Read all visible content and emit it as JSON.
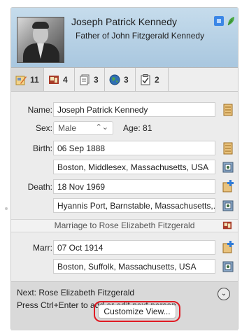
{
  "header": {
    "name": "Joseph Patrick Kennedy",
    "subtitle": "Father of John Fitzgerald Kennedy",
    "accent_color": "#3b86e6"
  },
  "tabs": [
    {
      "icon": "edit-person-icon",
      "count": "11"
    },
    {
      "icon": "media-icon",
      "count": "4"
    },
    {
      "icon": "sources-icon",
      "count": "3"
    },
    {
      "icon": "globe-icon",
      "count": "3"
    },
    {
      "icon": "tasks-icon",
      "count": "2"
    }
  ],
  "fields": {
    "name_label": "Name:",
    "name_value": "Joseph Patrick Kennedy",
    "sex_label": "Sex:",
    "sex_value": "Male",
    "age_label": "Age:",
    "age_value": "81",
    "birth_label": "Birth:",
    "birth_date": "06 Sep 1888",
    "birth_place": "Boston, Middlesex, Massachusetts, USA",
    "death_label": "Death:",
    "death_date": "18 Nov 1969",
    "death_place": "Hyannis Port, Barnstable, Massachusetts,...",
    "marriage_header": "Marriage to Rose Elizabeth Fitzgerald",
    "marr_label": "Marr:",
    "marr_date": "07 Oct 1914",
    "marr_place": "Boston, Suffolk, Massachusetts, USA"
  },
  "next": {
    "line1": "Next:  Rose Elizabeth Fitzgerald",
    "line2": "Press Ctrl+Enter to add or edit next person"
  },
  "customize_label": "Customize View..."
}
